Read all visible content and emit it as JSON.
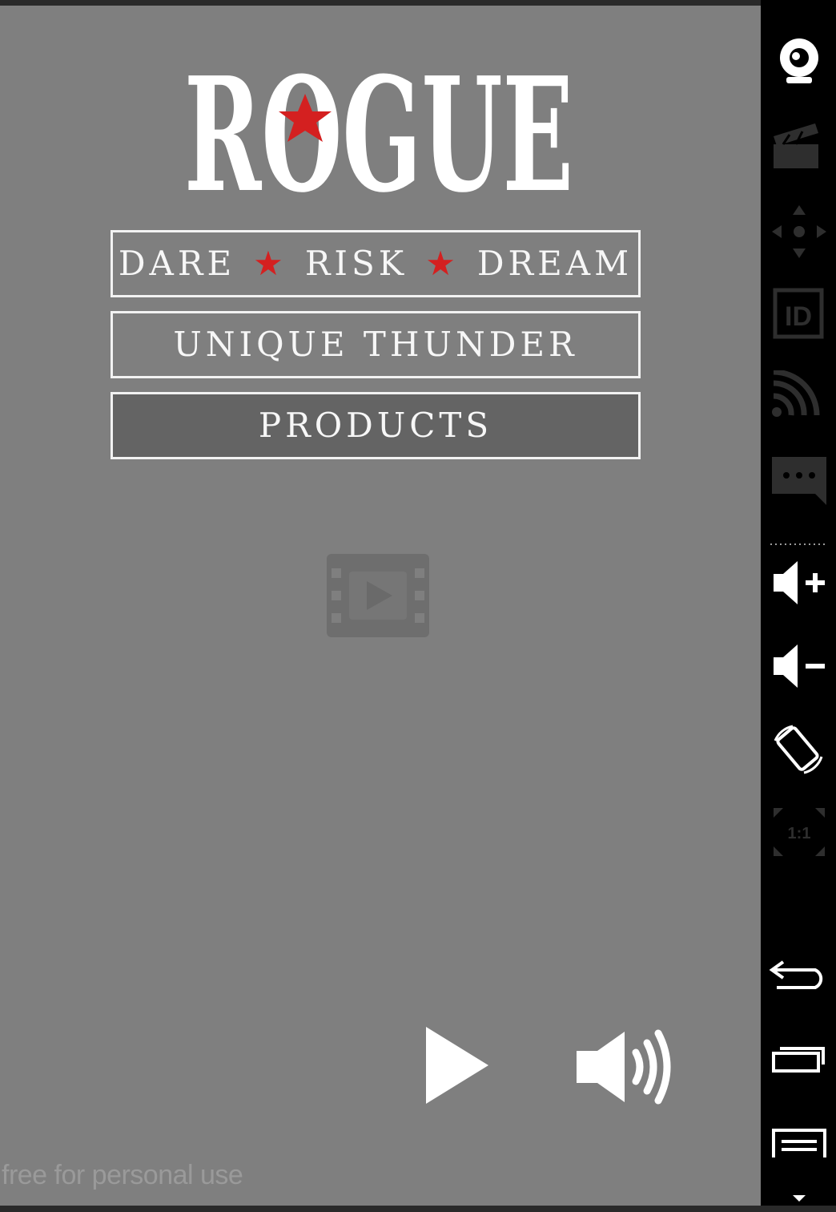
{
  "app": {
    "logo_text": "ROGUE",
    "tagline": {
      "words": [
        "DARE",
        "RISK",
        "DREAM"
      ],
      "separator": "★"
    },
    "menu": {
      "unique_label": "UNIQUE THUNDER",
      "products_label": "PRODUCTS"
    },
    "video_placeholder_icon": "film-play-icon",
    "player": {
      "play_icon": "play-icon",
      "sound_icon": "volume-icon"
    },
    "watermark": "free for personal use"
  },
  "emulator_toolbar": {
    "items": [
      {
        "icon": "webcam-icon",
        "enabled": true
      },
      {
        "icon": "clapperboard-icon",
        "enabled": false
      },
      {
        "icon": "dpad-icon",
        "enabled": false
      },
      {
        "icon": "id-icon",
        "label": "ID",
        "enabled": false
      },
      {
        "icon": "cast-icon",
        "enabled": false
      },
      {
        "icon": "chat-icon",
        "enabled": false
      },
      {
        "icon": "volume-up-icon",
        "enabled": true
      },
      {
        "icon": "volume-down-icon",
        "enabled": true
      },
      {
        "icon": "rotate-icon",
        "enabled": true
      },
      {
        "icon": "pixel-perfect-icon",
        "label": "1:1",
        "enabled": false
      },
      {
        "icon": "back-icon",
        "enabled": true
      },
      {
        "icon": "recent-apps-icon",
        "enabled": true
      },
      {
        "icon": "menu-icon",
        "enabled": true
      }
    ]
  },
  "colors": {
    "background": "#7f7f7f",
    "accent_red": "#d42020",
    "text": "#ffffff",
    "toolbar_bg": "#000000",
    "toolbar_disabled": "#2e2e2e"
  }
}
